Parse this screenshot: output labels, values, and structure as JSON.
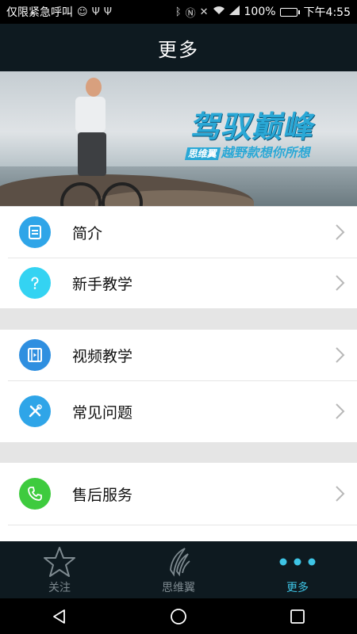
{
  "status_bar": {
    "left_text": "仅限紧急呼叫",
    "battery_percent": "100%",
    "time": "下午4:55",
    "battery_level": 1.0
  },
  "header": {
    "title": "更多"
  },
  "banner": {
    "slogan_main": "驾驭巅峰",
    "slogan_tag": "思维翼",
    "slogan_sub": "越野款想你所想"
  },
  "menu_groups": [
    [
      {
        "label": "简介",
        "icon": "document-icon",
        "color": "#2fa5e8"
      },
      {
        "label": "新手教学",
        "icon": "question-icon",
        "color": "#34d3f2"
      }
    ],
    [
      {
        "label": "视频教学",
        "icon": "film-icon",
        "color": "#2f8fe0"
      },
      {
        "label": "常见问题",
        "icon": "tools-icon",
        "color": "#2fa5e8"
      }
    ],
    [
      {
        "label": "售后服务",
        "icon": "phone-icon",
        "color": "#3ecb3e"
      }
    ]
  ],
  "tabs": [
    {
      "label": "关注",
      "icon": "star-icon",
      "active": false
    },
    {
      "label": "思维翼",
      "icon": "wing-logo-icon",
      "active": false
    },
    {
      "label": "更多",
      "icon": "more-dots-icon",
      "active": true
    }
  ],
  "colors": {
    "header_bg": "#0e1a20",
    "tab_active": "#3ec5e6",
    "tab_inactive": "#7e8a90",
    "page_bg": "#e5e5e5"
  }
}
